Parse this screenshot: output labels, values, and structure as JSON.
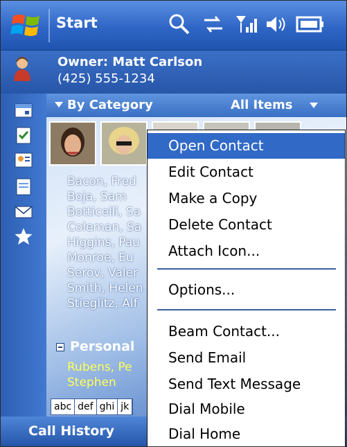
{
  "titlebar": {
    "title": "Start"
  },
  "owner": {
    "name": "Owner: Matt Carlson",
    "phone": "(425) 555-1234"
  },
  "category_bar": {
    "filter": "By Category",
    "view": "All Items"
  },
  "contacts": [
    "Bacon, Fred",
    "Boja, Sam",
    "Botticelli, Sa",
    "Coleman, Sa",
    "Higgins, Pau",
    "Monroe, Eu",
    "Serov, Valer",
    "Smith, Helen",
    "Stieglitz, Alf"
  ],
  "personal": {
    "header": "Personal",
    "items": [
      "Rubens, Pe",
      "Stephen"
    ]
  },
  "alpha_index": [
    "abc",
    "def",
    "ghi",
    "jk"
  ],
  "softkey": {
    "left": "Call History"
  },
  "menu": {
    "open": "Open Contact",
    "edit": "Edit Contact",
    "copy": "Make a Copy",
    "delete": "Delete Contact",
    "attach": "Attach Icon...",
    "options": "Options...",
    "beam": "Beam Contact...",
    "email": "Send Email",
    "text": "Send Text Message",
    "mobile": "Dial Mobile",
    "home": "Dial Home"
  },
  "colors": {
    "accent": "#3169c6",
    "title_bar": "#2f66c6",
    "personal_text": "#ffff55"
  }
}
